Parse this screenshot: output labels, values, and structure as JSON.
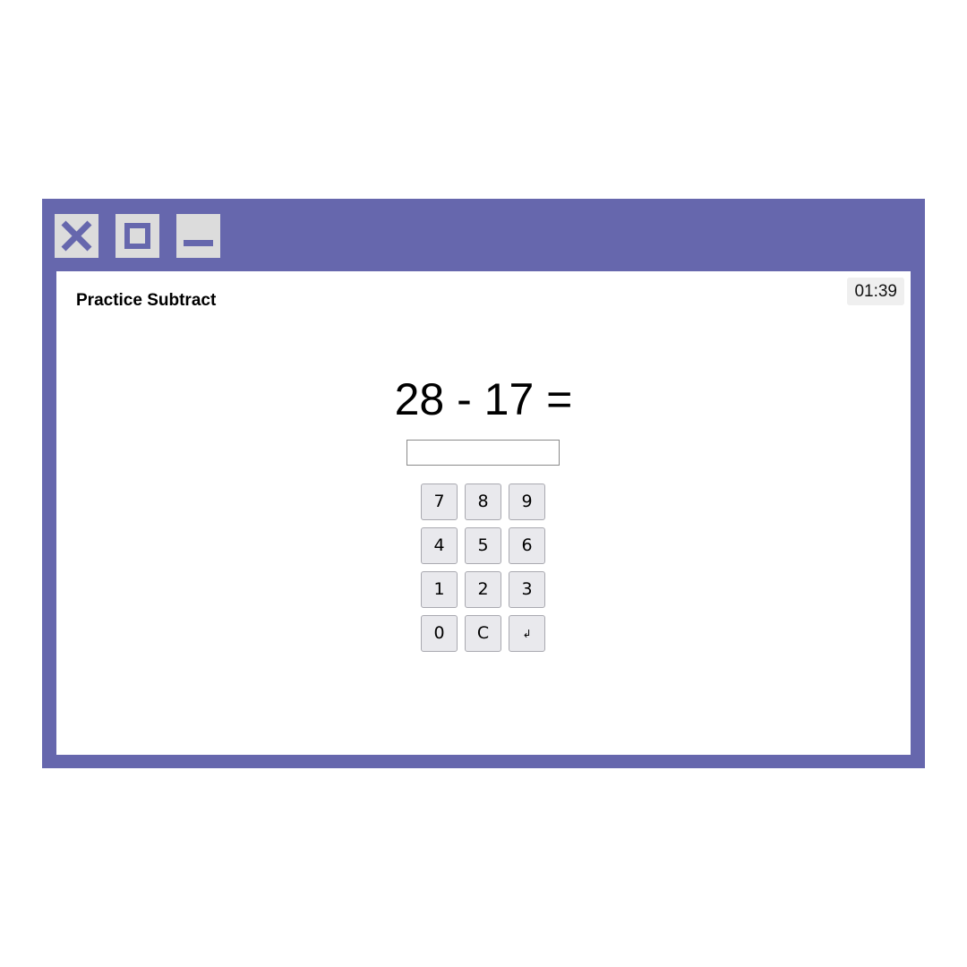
{
  "window": {
    "frame_color": "#6667ad",
    "titlebar_buttons": [
      {
        "name": "close",
        "icon": "close-icon"
      },
      {
        "name": "maximize",
        "icon": "maximize-icon"
      },
      {
        "name": "minimize",
        "icon": "minimize-icon"
      }
    ]
  },
  "app": {
    "title": "Practice Subtract",
    "timer": "01:39"
  },
  "problem": {
    "expression": "28 - 17 ="
  },
  "answer": {
    "value": "",
    "placeholder": ""
  },
  "keypad": {
    "keys": [
      "7",
      "8",
      "9",
      "4",
      "5",
      "6",
      "1",
      "2",
      "3",
      "0",
      "C",
      "↲"
    ]
  }
}
